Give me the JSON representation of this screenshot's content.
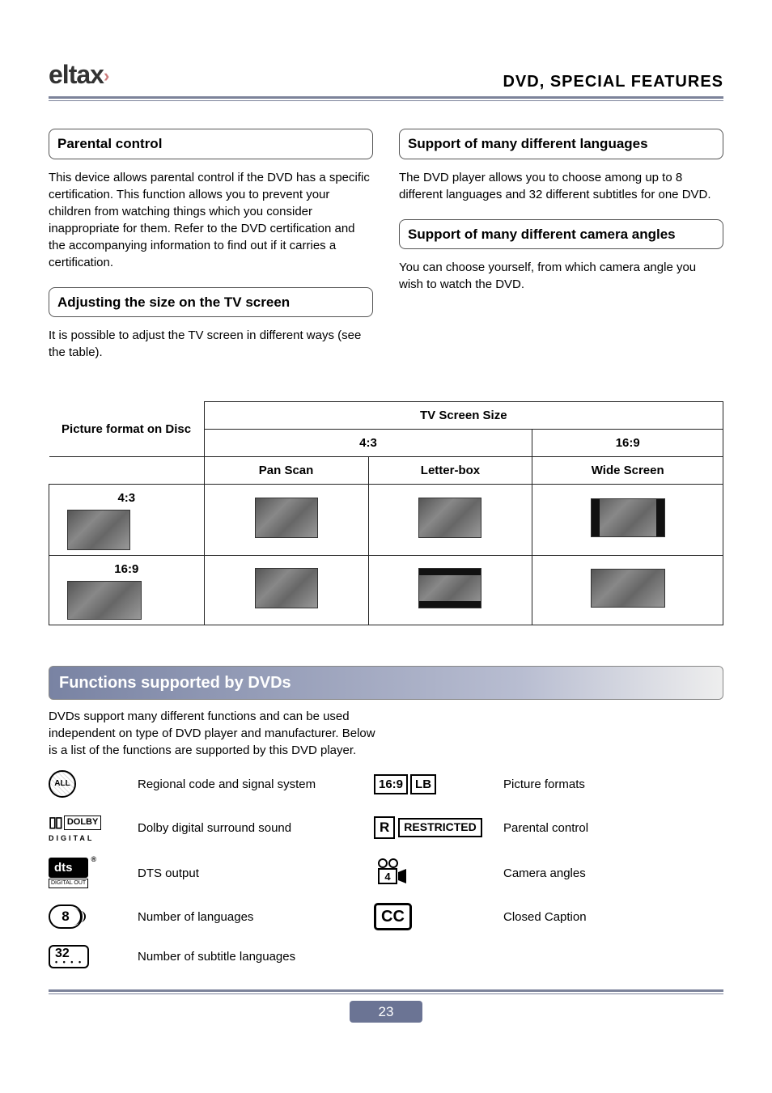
{
  "brand": "eltax",
  "title": "DVD, SPECIAL FEATURES",
  "left": {
    "h1": "Parental control",
    "p1": "This device allows parental control if the DVD has a specific certification. This function allows you to prevent your children from watching things which you consider inappropriate for them. Refer to the DVD certification and the accompanying information to find out if it carries a certification.",
    "h2": "Adjusting the size on the TV screen",
    "p2": "It is possible to adjust the TV screen in different ways (see the table)."
  },
  "right": {
    "h1": "Support of many different languages",
    "p1": "The DVD player allows you to choose among up to 8 different languages and 32 different subtitles for one DVD.",
    "h2": "Support of many different camera angles",
    "p2": "You can choose yourself, from which camera angle you wish to watch the DVD."
  },
  "table": {
    "top": "TV Screen Size",
    "col0": "Picture format on Disc",
    "c43": "4:3",
    "c169": "16:9",
    "pan": "Pan Scan",
    "lb": "Letter-box",
    "ws": "Wide Screen",
    "r1": "4:3",
    "r2": "16:9"
  },
  "section2": {
    "bar": "Functions supported by DVDs",
    "intro": "DVDs support many different functions and can be used independent on type of DVD player and manufacturer. Below is a list of the functions are supported by this DVD player."
  },
  "icons": {
    "globe_text": "ALL",
    "regional": "Regional code and signal system",
    "dolby_word": "DOLBY",
    "dolby_sub": "DIGITAL",
    "dolby": "Dolby digital surround sound",
    "dts_word": "dts",
    "dts_sub": "DIGITAL OUT",
    "dts": "DTS output",
    "lang_num": "8",
    "languages": "Number of languages",
    "sub_num": "32",
    "subtitles": "Number of subtitle languages",
    "fmt_a": "16:9",
    "fmt_b": "LB",
    "formats": "Picture formats",
    "r_letter": "R",
    "r_word": "RESTRICTED",
    "parental": "Parental control",
    "cam_num": "4",
    "camera": "Camera angles",
    "cc": "CC",
    "caption": "Closed Caption"
  },
  "page_number": "23"
}
